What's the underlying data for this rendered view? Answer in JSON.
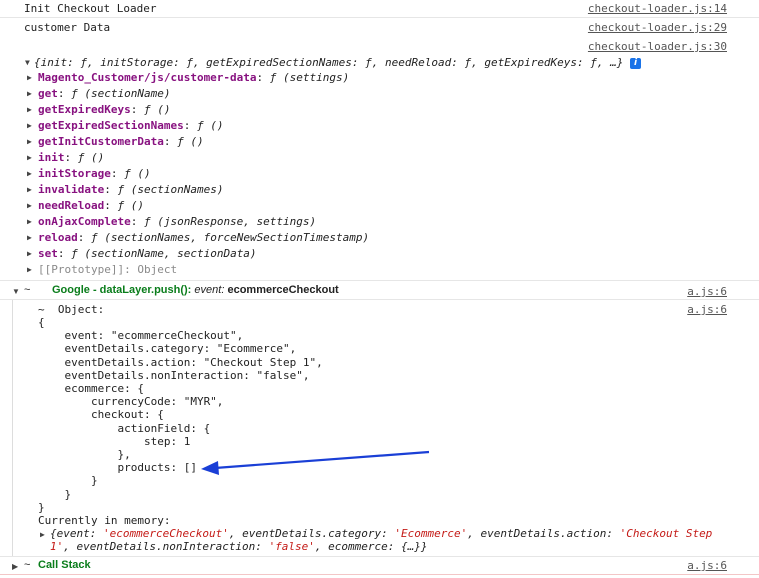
{
  "console": {
    "log1": {
      "text": "Init Checkout Loader",
      "source": "checkout-loader.js:14"
    },
    "log2": {
      "text": "customer Data",
      "source": "checkout-loader.js:29"
    },
    "log3": {
      "source": "checkout-loader.js:30"
    },
    "object_summary": "{init: ƒ, initStorage: ƒ, getExpiredSectionNames: ƒ, needReload: ƒ, getExpiredKeys: ƒ, …}",
    "info_glyph": "i",
    "props": [
      {
        "key": "Magento_Customer/js/customer-data",
        "value": "ƒ (settings)"
      },
      {
        "key": "get",
        "value": "ƒ (sectionName)"
      },
      {
        "key": "getExpiredKeys",
        "value": "ƒ ()"
      },
      {
        "key": "getExpiredSectionNames",
        "value": "ƒ ()"
      },
      {
        "key": "getInitCustomerData",
        "value": "ƒ ()"
      },
      {
        "key": "init",
        "value": "ƒ ()"
      },
      {
        "key": "initStorage",
        "value": "ƒ ()"
      },
      {
        "key": "invalidate",
        "value": "ƒ (sectionNames)"
      },
      {
        "key": "needReload",
        "value": "ƒ ()"
      },
      {
        "key": "onAjaxComplete",
        "value": "ƒ (jsonResponse, settings)"
      },
      {
        "key": "reload",
        "value": "ƒ (sectionNames, forceNewSectionTimestamp)"
      },
      {
        "key": "set",
        "value": "ƒ (sectionName, sectionData)"
      }
    ],
    "prototype": "[[Prototype]]: Object",
    "group": {
      "tilde": "~",
      "title": "Google - dataLayer.push():",
      "event_label": "event:",
      "event_value": "ecommerceCheckout",
      "source": "a.js:6"
    },
    "object_header": "~  Object:",
    "object_source": "a.js:6",
    "object_lines": [
      "{",
      "    event: \"ecommerceCheckout\",",
      "    eventDetails.category: \"Ecommerce\",",
      "    eventDetails.action: \"Checkout Step 1\",",
      "    eventDetails.nonInteraction: \"false\",",
      "    ecommerce: {",
      "        currencyCode: \"MYR\",",
      "        checkout: {",
      "            actionField: {",
      "                step: 1",
      "            },",
      "            products: []",
      "        }",
      "    }",
      "}"
    ],
    "memory_label": "Currently in memory:",
    "memory_line1": {
      "open": "{",
      "k1": "event: ",
      "v1": "'ecommerceCheckout'",
      "k2": ", eventDetails.category: ",
      "v2": "'Ecommerce'",
      "k3": ", eventDetails.action: ",
      "v3": "'Checkout Step"
    },
    "memory_line2": {
      "v3b": "1'",
      "k4": ", eventDetails.nonInteraction: ",
      "v4": "'false'",
      "k5": ", ecommerce: ",
      "v5": "{…}}"
    },
    "callstack": {
      "tilde": "~",
      "label": "Call Stack",
      "source": "a.js:6"
    }
  },
  "colors": {
    "arrow": "#1a3fd6",
    "group_title": "#0a7d1b",
    "key": "#881280",
    "string": "#c41a16"
  }
}
